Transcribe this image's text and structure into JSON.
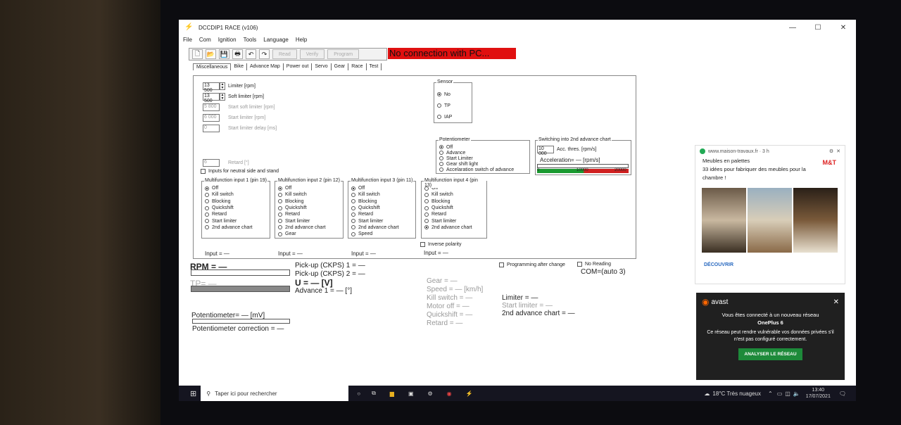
{
  "window": {
    "title": "DCCDIP1 RACE (v106)"
  },
  "menu": [
    "File",
    "Com",
    "Ignition",
    "Tools",
    "Language",
    "Help"
  ],
  "toolbar": {
    "read": "Read",
    "verify": "Verify",
    "program": "Program"
  },
  "connection_status": "No connection with PC...",
  "tabs": [
    "Miscellaneous",
    "Bike",
    "Advance Map",
    "Power out",
    "Servo",
    "Gear",
    "Race",
    "Test"
  ],
  "spins": [
    {
      "value": "13 500",
      "label": "Limiter [rpm]"
    },
    {
      "value": "13 500",
      "label": "Soft limiter [rpm]"
    },
    {
      "value": "5 800",
      "label": "Start soft limiter [rpm]"
    },
    {
      "value": "6 000",
      "label": "Start limiter [rpm]"
    },
    {
      "value": "0",
      "label": "Start limiter delay [ms]"
    }
  ],
  "retard": {
    "value": "6",
    "label": "Retard [°]"
  },
  "neutral_checkbox": "Inputs for neutral side and stand",
  "sensor": {
    "title": "Sensor",
    "options": [
      "No",
      "TP",
      "IAP"
    ]
  },
  "potentiometer": {
    "title": "Potentiometer",
    "options": [
      "Off",
      "Advance",
      "Start Limiter",
      "Gear shift light",
      "Accelaration switch of advance"
    ]
  },
  "switching": {
    "title": "Switching into 2nd advance chart",
    "value": "10 000",
    "label": "Acc. thres. [rpm/s]",
    "accel_label": "Acceleration= — [rpm/s]",
    "scale": [
      "0",
      "10000",
      "20000"
    ]
  },
  "multifunction": [
    {
      "title": "Multifunction input 1 (pin 19)",
      "options": [
        "Off",
        "Kill switch",
        "Blocking",
        "Quickshift",
        "Retard",
        "Start limiter",
        "2nd advance chart"
      ],
      "input": "Input = —"
    },
    {
      "title": "Multifunction input 2 (pin 12)",
      "options": [
        "Off",
        "Kill switch",
        "Blocking",
        "Quickshift",
        "Retard",
        "Start limiter",
        "2nd advance chart",
        "Gear"
      ],
      "input": "Input = —"
    },
    {
      "title": "Multifunction input 3 (pin 11)",
      "options": [
        "Off",
        "Kill switch",
        "Blocking",
        "Quickshift",
        "Retard",
        "Start limiter",
        "2nd advance chart",
        "Speed"
      ],
      "input": "Input = —"
    },
    {
      "title": "Multifunction input 4 (pin 13)",
      "options": [
        "Off",
        "Kill switch",
        "Blocking",
        "Quickshift",
        "Retard",
        "Start limiter",
        "2nd advance chart"
      ],
      "input": "Input = —"
    }
  ],
  "inverse_polarity": "Inverse polarity",
  "programming_after_change": "Programming after change",
  "no_reading": "No Reading",
  "com": "COM=(auto 3)",
  "status": {
    "rpm": "RPM = —",
    "tp": "TP= —",
    "pickup1": "Pick-up (CKPS) 1 = —",
    "pickup2": "Pick-up (CKPS) 2 = —",
    "u": "U = — [V]",
    "advance": "Advance 1 = — [°]",
    "pot": "Potentiometer= — [mV]",
    "pot_corr": "Potentiometer correction = —",
    "gear": "Gear = —",
    "speed": "Speed = — [km/h]",
    "kill": "Kill switch = —",
    "motor_off": "Motor off = —",
    "quickshift": "Quickshift = —",
    "retard": "Retard = —",
    "limiter": "Limiter = —",
    "start_limiter": "Start limiter = —",
    "adv2": "2nd advance chart = —"
  },
  "notification": {
    "site": "www.maison-travaux.fr · 3 h",
    "title": "Meubles en palettes",
    "body": "33 idées pour fabriquer des meubles pour la chambre !",
    "logo": "M&T",
    "button": "DÉCOUVRIR"
  },
  "avast": {
    "brand": "avast",
    "line1": "Vous êtes connecté à un nouveau réseau",
    "network": "OnePlus 6",
    "line2": "Ce réseau peut rendre vulnérable vos données privées s'il n'est pas configuré correctement.",
    "button": "ANALYSER LE RÉSEAU"
  },
  "taskbar": {
    "search": "Taper ici pour rechercher",
    "weather": "18°C  Très nuageux",
    "time": "13:40",
    "date": "17/07/2021"
  }
}
